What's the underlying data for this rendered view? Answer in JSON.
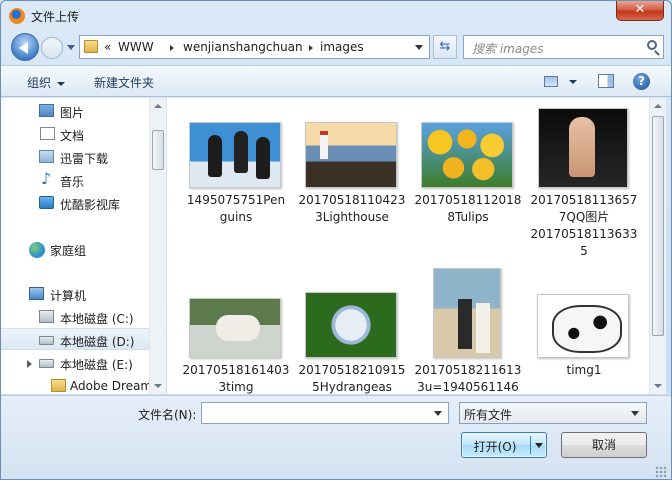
{
  "window": {
    "title": "文件上传",
    "close_symbol": "✕"
  },
  "address_bar": {
    "overflow": "«",
    "segments": [
      "WWW",
      "wenjianshangchuan",
      "images"
    ]
  },
  "search": {
    "placeholder": "搜索 images"
  },
  "toolbar": {
    "organize_label": "组织",
    "new_folder_label": "新建文件夹",
    "help_symbol": "?"
  },
  "nav_pane": {
    "libraries": [
      {
        "label": "图片",
        "icon": "pictures-icon"
      },
      {
        "label": "文档",
        "icon": "documents-icon"
      },
      {
        "label": "迅雷下载",
        "icon": "downloads-icon"
      },
      {
        "label": "音乐",
        "icon": "music-icon"
      },
      {
        "label": "优酷影视库",
        "icon": "video-library-icon"
      }
    ],
    "homegroup": {
      "label": "家庭组",
      "icon": "homegroup-icon"
    },
    "computer": {
      "label": "计算机",
      "icon": "computer-icon"
    },
    "drives": [
      {
        "label": "本地磁盘 (C:)",
        "icon": "system-disk-icon",
        "selected": false
      },
      {
        "label": "本地磁盘 (D:)",
        "icon": "disk-icon",
        "selected": true
      },
      {
        "label": "本地磁盘 (E:)",
        "icon": "disk-icon",
        "selected": false
      }
    ],
    "folder": {
      "label": "Adobe Dream",
      "icon": "folder-icon"
    }
  },
  "files": [
    {
      "name": "1495075751Penguins",
      "lines": [
        "1495075751Pen",
        "guins"
      ]
    },
    {
      "name": "201705181104233Lighthouse",
      "lines": [
        "20170518110423",
        "3Lighthouse"
      ]
    },
    {
      "name": "201705181120188Tulips",
      "lines": [
        "20170518112018",
        "8Tulips"
      ]
    },
    {
      "name": "201705181136577QQ图片201705181136335",
      "lines": [
        "20170518113657",
        "7QQ图片",
        "20170518113633",
        "5"
      ]
    },
    {
      "name": "201705181614033timg",
      "lines": [
        "20170518161403",
        "3timg"
      ]
    },
    {
      "name": "201705182109155Hydrangeas",
      "lines": [
        "20170518210915",
        "5Hydrangeas"
      ]
    },
    {
      "name": "201705182116133u=1940561146",
      "lines": [
        "20170518211613",
        "3u=1940561146"
      ]
    },
    {
      "name": "timg1",
      "lines": [
        "timg1"
      ]
    }
  ],
  "bottom": {
    "filename_label": "文件名(N):",
    "filename_value": "",
    "filetype_value": "所有文件",
    "open_label": "打开(O)",
    "cancel_label": "取消"
  }
}
